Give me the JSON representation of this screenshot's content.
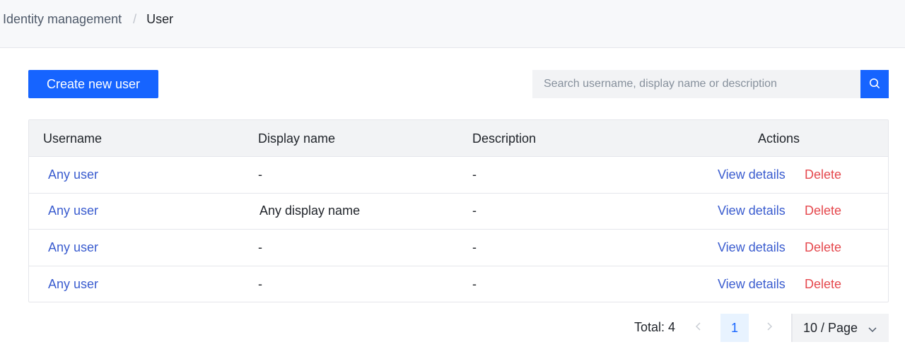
{
  "breadcrumb": {
    "parent": "Identity management",
    "separator": "/",
    "current": "User"
  },
  "toolbar": {
    "create_label": "Create new user",
    "search_placeholder": "Search username, display name or description",
    "search_value": ""
  },
  "table": {
    "columns": [
      "Username",
      "Display name",
      "Description",
      "Actions"
    ],
    "rows": [
      {
        "username": "Any user",
        "display_name": "-",
        "description": "-",
        "view": "View details",
        "delete": "Delete"
      },
      {
        "username": "Any user",
        "display_name": "Any display name",
        "description": "-",
        "view": "View details",
        "delete": "Delete"
      },
      {
        "username": "Any user",
        "display_name": "-",
        "description": "-",
        "view": "View details",
        "delete": "Delete"
      },
      {
        "username": "Any user",
        "display_name": "-",
        "description": "-",
        "view": "View details",
        "delete": "Delete"
      }
    ]
  },
  "pagination": {
    "total_label": "Total: 4",
    "current_page": "1",
    "page_size": "10 / Page"
  },
  "colors": {
    "primary": "#1664ff",
    "link": "#3a5ccf",
    "danger": "#e5484d",
    "header_bg": "#f2f3f5"
  },
  "icons": {
    "search": "search-icon",
    "prev": "chevron-left-icon",
    "next": "chevron-right-icon",
    "dropdown": "chevron-down-icon"
  }
}
